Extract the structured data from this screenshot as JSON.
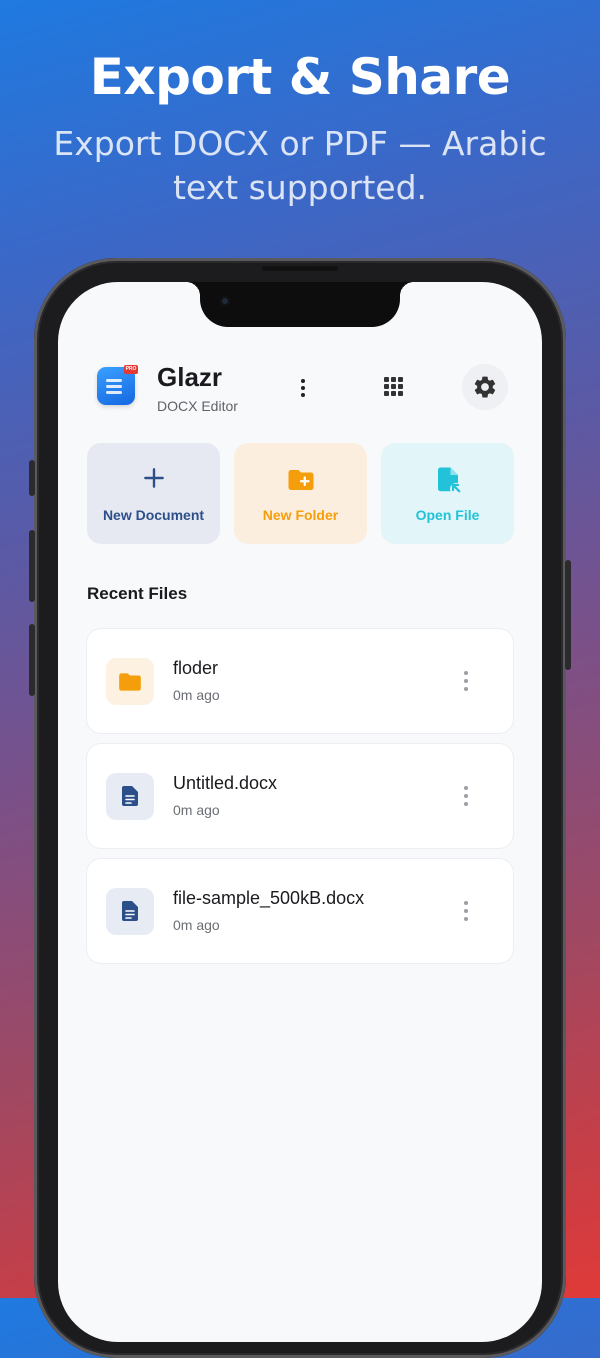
{
  "promo": {
    "headline": "Export & Share",
    "subline": "Export DOCX or PDF — Arabic text supported."
  },
  "app": {
    "name": "Glazr",
    "subtitle": "DOCX Editor",
    "icon": "doc-app-icon",
    "badge": "PRO"
  },
  "header": {
    "menu_icon": "more-vertical-icon",
    "grid_icon": "apps-grid-icon",
    "settings_icon": "gear-icon"
  },
  "actions": [
    {
      "label": "New Document",
      "icon": "plus-icon",
      "color": "#2c4f8a",
      "bg": "#e6e9f2"
    },
    {
      "label": "New Folder",
      "icon": "folder-plus-icon",
      "color": "#f59e0b",
      "bg": "#fbeedf"
    },
    {
      "label": "Open File",
      "icon": "open-file-icon",
      "color": "#22c3d8",
      "bg": "#e2f5f8"
    }
  ],
  "recent": {
    "title": "Recent Files",
    "items": [
      {
        "name": "floder",
        "time": "0m ago",
        "icon": "folder-icon"
      },
      {
        "name": "Untitled.docx",
        "time": "0m ago",
        "icon": "document-icon"
      },
      {
        "name": "file-sample_500kB.docx",
        "time": "0m ago",
        "icon": "document-icon"
      }
    ]
  }
}
